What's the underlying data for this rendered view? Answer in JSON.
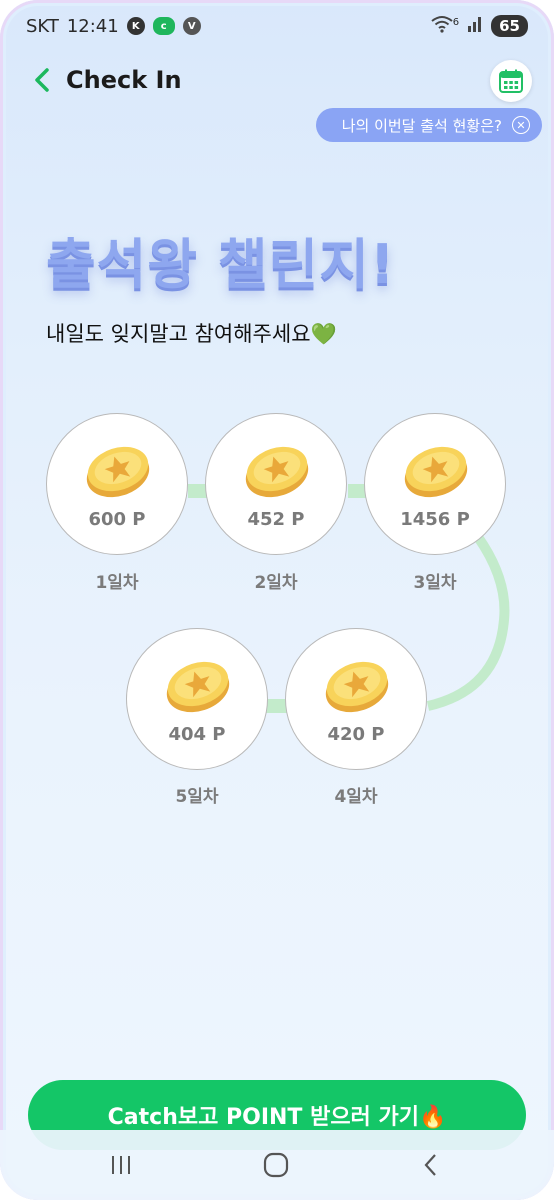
{
  "status": {
    "carrier": "SKT",
    "time": "12:41",
    "battery": "65",
    "wifi_gen": "6"
  },
  "header": {
    "title": "Check In",
    "tooltip": "나의 이번달 출석 현황은?"
  },
  "hero": {
    "title": "출석왕 챌린지!",
    "subtitle": "내일도 잊지말고 참여해주세요💚"
  },
  "days": [
    {
      "points": "600 P",
      "label": "1일차"
    },
    {
      "points": "452 P",
      "label": "2일차"
    },
    {
      "points": "1456 P",
      "label": "3일차"
    },
    {
      "points": "420 P",
      "label": "4일차"
    },
    {
      "points": "404 P",
      "label": "5일차"
    }
  ],
  "cta": {
    "label": "Catch보고 POINT 받으러 가기🔥"
  },
  "colors": {
    "accent": "#14c667",
    "tooltip_bg": "#8aa4f4",
    "hero_text": "#8ea7ef",
    "path": "#c3ebcb"
  },
  "icons": [
    "back-chevron-icon",
    "calendar-icon",
    "close-circle-icon",
    "coin-icon",
    "recent-apps-icon",
    "home-icon",
    "back-icon"
  ]
}
